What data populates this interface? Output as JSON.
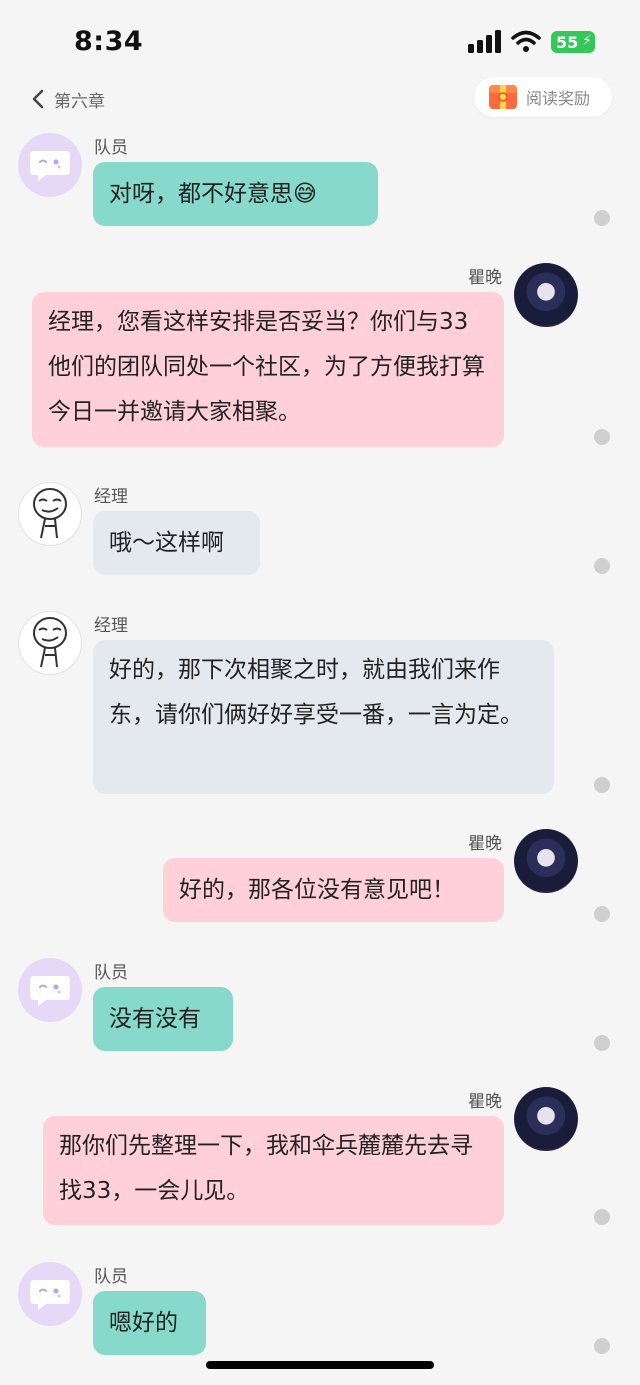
{
  "status_bar": {
    "time": "8:34",
    "battery": "55"
  },
  "nav": {
    "back_label": "第六章",
    "reward_label": "阅读奖励"
  },
  "messages": [
    {
      "sender": "队员",
      "text": "对呀，都不好意思😅"
    },
    {
      "sender": "瞿晚",
      "text": "经理，您看这样安排是否妥当？你们与33他们的团队同处一个社区，为了方便我打算今日一并邀请大家相聚。"
    },
    {
      "sender": "经理",
      "text": "哦～这样啊"
    },
    {
      "sender": "经理",
      "text": "好的，那下次相聚之时，就由我们来作东，请你们俩好好享受一番，一言为定。"
    },
    {
      "sender": "瞿晚",
      "text": "好的，那各位没有意见吧！"
    },
    {
      "sender": "队员",
      "text": "没有没有"
    },
    {
      "sender": "瞿晚",
      "text": "那你们先整理一下，我和伞兵麓麓先去寻找33，一会儿见。"
    },
    {
      "sender": "队员",
      "text": "嗯好的"
    }
  ],
  "colors": {
    "teal_bubble": "#87d9cb",
    "pink_bubble": "#ffd0da",
    "gray_bubble": "#e4e8ef",
    "background": "#f5f5f5"
  }
}
